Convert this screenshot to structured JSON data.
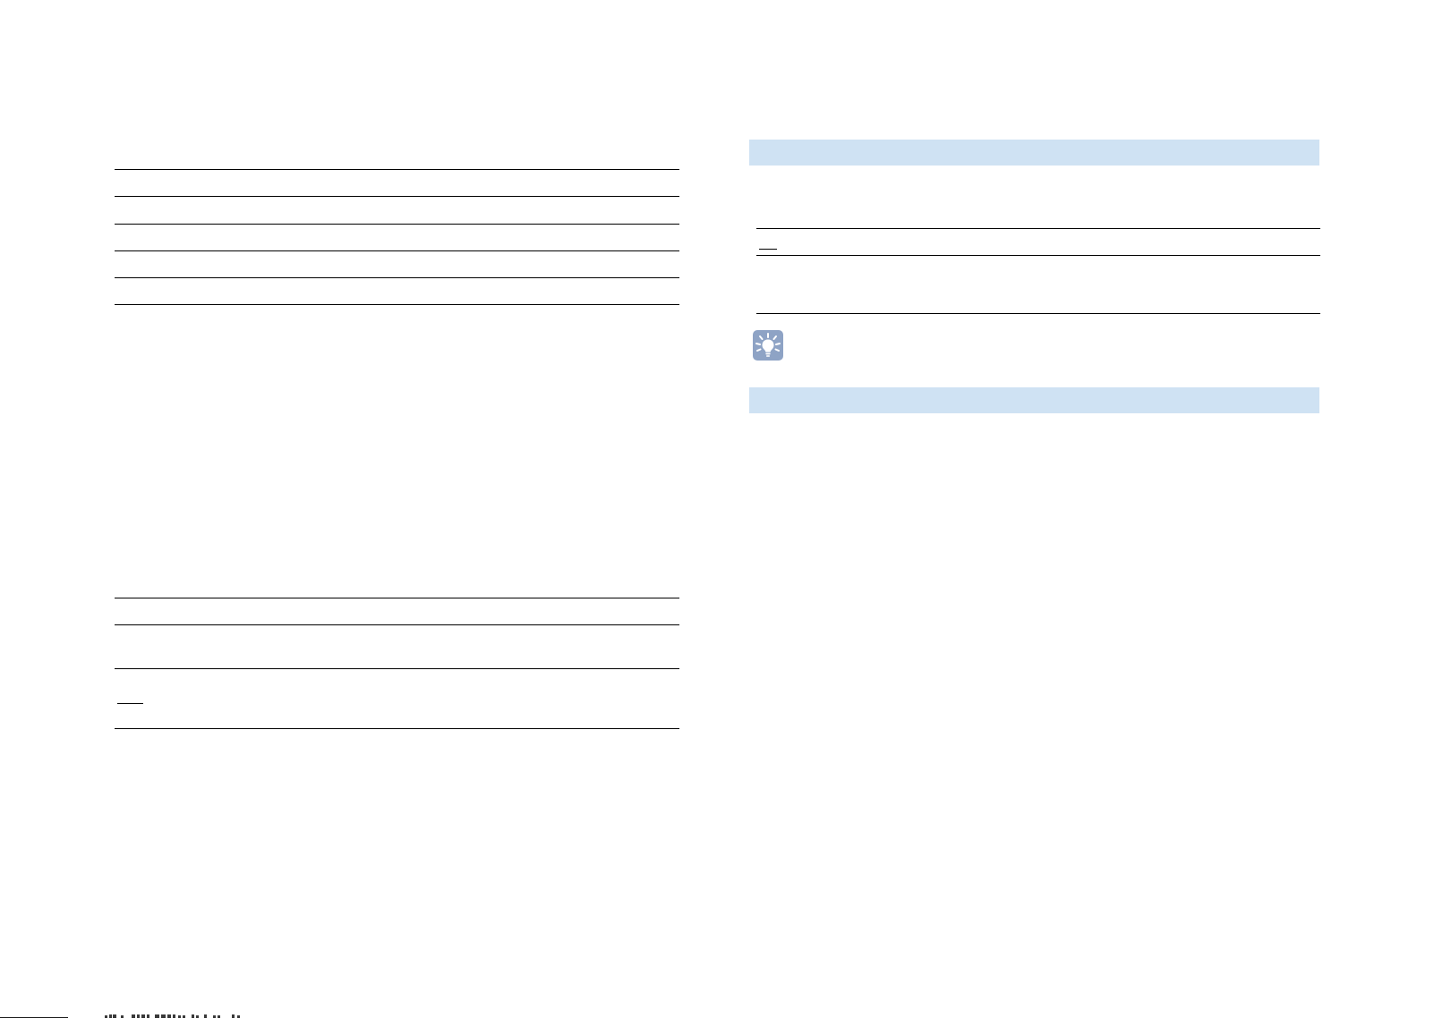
{
  "colors": {
    "section_band": "#cfe2f3",
    "tip_icon_background": "#8ea3c5",
    "rule": "#000000"
  },
  "icons": {
    "tip": "lightbulb-icon"
  }
}
